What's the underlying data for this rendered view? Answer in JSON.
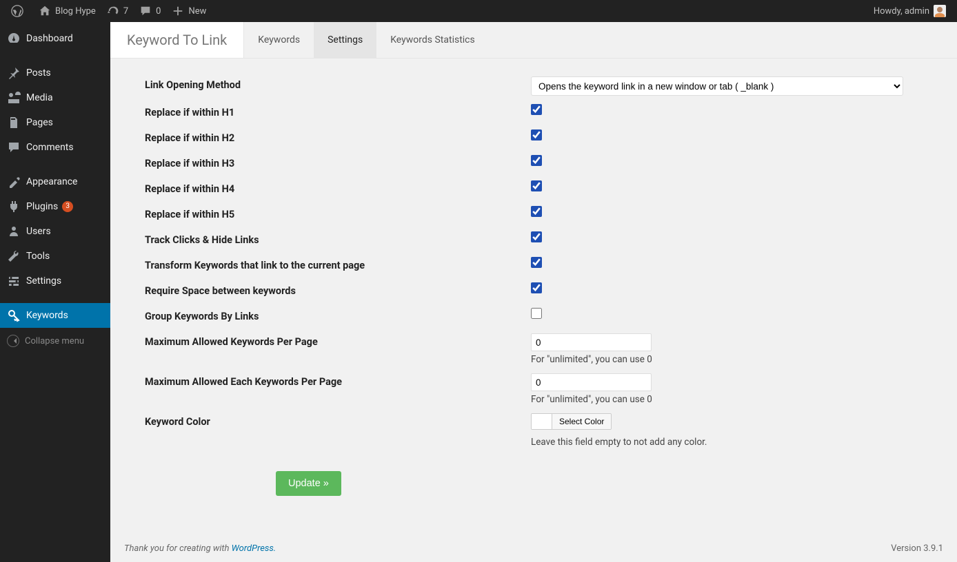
{
  "adminbar": {
    "site_name": "Blog Hype",
    "updates_count": "7",
    "comments_count": "0",
    "new_label": "New",
    "howdy": "Howdy, admin"
  },
  "sidebar": {
    "items": [
      {
        "label": "Dashboard"
      },
      {
        "label": "Posts"
      },
      {
        "label": "Media"
      },
      {
        "label": "Pages"
      },
      {
        "label": "Comments"
      },
      {
        "label": "Appearance"
      },
      {
        "label": "Plugins",
        "badge": "3"
      },
      {
        "label": "Users"
      },
      {
        "label": "Tools"
      },
      {
        "label": "Settings"
      },
      {
        "label": "Keywords"
      }
    ],
    "collapse_label": "Collapse menu"
  },
  "header": {
    "title": "Keyword To Link",
    "tabs": [
      {
        "label": "Keywords"
      },
      {
        "label": "Settings"
      },
      {
        "label": "Keywords Statistics"
      }
    ]
  },
  "settings": {
    "link_method_label": "Link Opening Method",
    "link_method_value": "Opens the keyword link in a new window or tab ( _blank )",
    "h1_label": "Replace if within H1",
    "h2_label": "Replace if within H2",
    "h3_label": "Replace if within H3",
    "h4_label": "Replace if within H4",
    "h5_label": "Replace if within H5",
    "track_label": "Track Clicks & Hide Links",
    "transform_label": "Transform Keywords that link to the current page",
    "space_label": "Require Space between keywords",
    "group_label": "Group Keywords By Links",
    "max_per_page_label": "Maximum Allowed Keywords Per Page",
    "max_per_page_value": "0",
    "max_per_page_desc": "For \"unlimited\", you can use 0",
    "max_each_label": "Maximum Allowed Each Keywords Per Page",
    "max_each_value": "0",
    "max_each_desc": "For \"unlimited\", you can use 0",
    "color_label": "Keyword Color",
    "color_button": "Select Color",
    "color_desc": "Leave this field empty to not add any color.",
    "submit_label": "Update »"
  },
  "footer": {
    "thank_prefix": "Thank you for creating with ",
    "thank_link": "WordPress.",
    "version": "Version 3.9.1"
  }
}
